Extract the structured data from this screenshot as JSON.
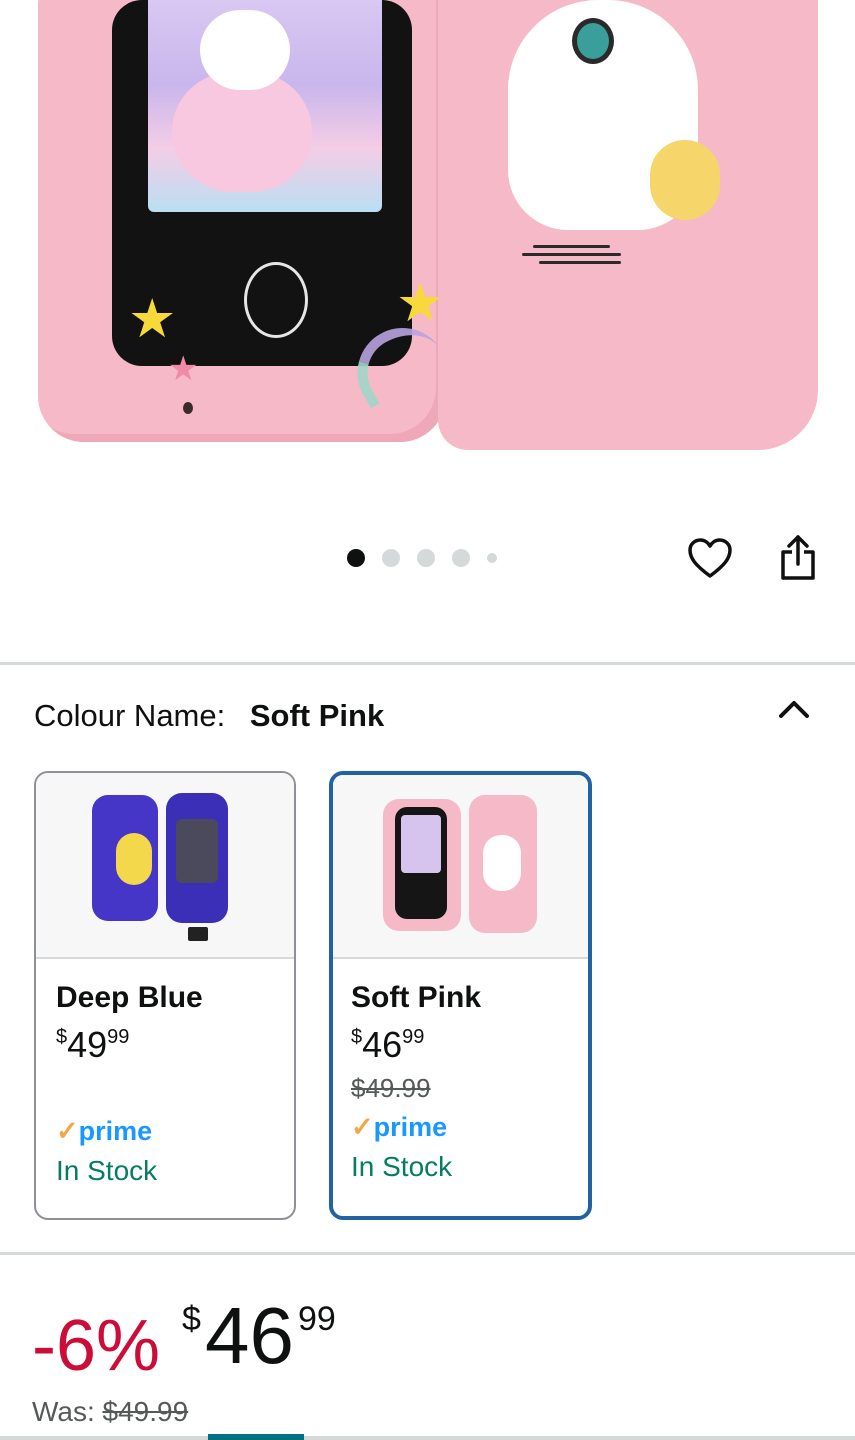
{
  "gallery": {
    "dots": 5,
    "active_dot": 0,
    "wishlist_icon": "heart-icon",
    "share_icon": "share-icon"
  },
  "colour": {
    "label": "Colour Name:",
    "selected": "Soft Pink",
    "toggle_icon": "chevron-up-icon"
  },
  "swatches": [
    {
      "name": "Deep Blue",
      "price_symbol": "$",
      "price_whole": "49",
      "price_fraction": "99",
      "list_price": "",
      "prime_check": "✓",
      "prime_label": "prime",
      "availability": "In Stock"
    },
    {
      "name": "Soft Pink",
      "price_symbol": "$",
      "price_whole": "46",
      "price_fraction": "99",
      "list_price": "$49.99",
      "prime_check": "✓",
      "prime_label": "prime",
      "availability": "In Stock"
    }
  ],
  "price": {
    "discount": "-6%",
    "symbol": "$",
    "whole": "46",
    "fraction": "99",
    "was_label": "Was:",
    "was_value": "$49.99"
  },
  "colors": {
    "accent_selected": "#2162a1",
    "discount_red": "#cc0c39",
    "stock_green": "#067d62",
    "prime_blue": "#1a98ff"
  }
}
